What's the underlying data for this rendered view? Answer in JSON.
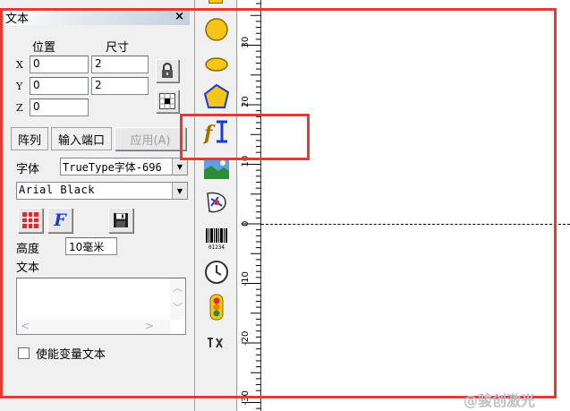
{
  "panel": {
    "title": "文本",
    "close": "×",
    "position_label": "位置",
    "size_label": "尺寸",
    "x_label": "X",
    "y_label": "Y",
    "z_label": "Z",
    "x_value": "0",
    "y_value": "0",
    "z_value": "0",
    "width_value": "2",
    "height_value": "2"
  },
  "tabs": {
    "array": "阵列",
    "input_port": "输入端口",
    "apply": "应用(A)"
  },
  "font": {
    "label": "字体",
    "type_value": "TrueType字体-696",
    "name_value": "Arial Black"
  },
  "height": {
    "label": "高度",
    "value": "10毫米"
  },
  "text_section": {
    "label": "文本",
    "value": ""
  },
  "checkbox": {
    "label": "使能变量文本",
    "checked": false
  },
  "toolbar": {
    "tools": [
      "circle-tool",
      "ellipse-tool",
      "polygon-tool",
      "text-tool",
      "bitmap-tool",
      "vector-file-tool",
      "barcode-tool",
      "time-tool",
      "io-lamp-tool",
      "delay-tool"
    ],
    "barcode_digits": "01234"
  },
  "ruler": {
    "labels": [
      "30",
      "20",
      "10",
      "0",
      "-10",
      "-20",
      "-30"
    ]
  },
  "watermark": "@骏创激光",
  "colors": {
    "annotation_red": "#e53935",
    "shape_yellow": "#f5c518"
  }
}
